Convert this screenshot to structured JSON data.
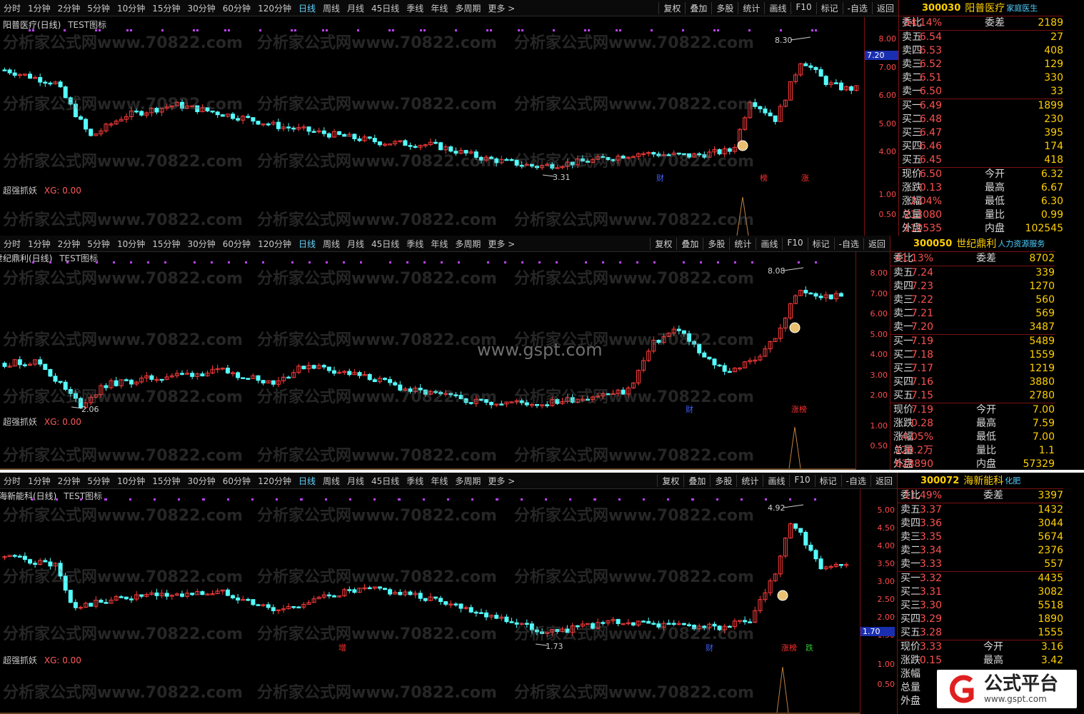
{
  "toolbar": {
    "periods": [
      "分时",
      "1分钟",
      "2分钟",
      "5分钟",
      "10分钟",
      "15分钟",
      "30分钟",
      "60分钟",
      "120分钟",
      "日线",
      "周线",
      "月线",
      "45日线",
      "季线",
      "年线",
      "多周期",
      "更多 >"
    ],
    "active_period": "日线",
    "right_buttons": [
      "复权",
      "叠加",
      "多股",
      "统计",
      "画线",
      "F10",
      "标记",
      "-自选",
      "返回"
    ]
  },
  "watermark": "分析家公式网www.70822.com",
  "site_watermark": "www.gspt.com",
  "logo": {
    "title": "公式平台",
    "url": "www.gspt.com"
  },
  "panels": [
    {
      "title": "阳普医疗(日线)",
      "indicator_tag": "TEST图标",
      "ind_name": "超强抓妖",
      "ind_value": "XG: 0.00",
      "code": "300030",
      "name": "阳普医疗",
      "industry": "家庭医生",
      "y_ticks": [
        "8.00",
        "7.00",
        "6.00",
        "5.00",
        "4.00"
      ],
      "ind_ticks": [
        "1.00",
        "0.50"
      ],
      "cur_price_tag": "7.20",
      "annotations": {
        "high": "8.30",
        "low": "3.31"
      },
      "marks": [
        "财",
        "榜",
        "涨"
      ],
      "quote": {
        "weibi": [
          "委比",
          "54.14%",
          "委差",
          "2189"
        ],
        "sell": [
          [
            "卖五",
            "6.54",
            "27"
          ],
          [
            "卖四",
            "6.53",
            "408"
          ],
          [
            "卖三",
            "6.52",
            "129"
          ],
          [
            "卖二",
            "6.51",
            "330"
          ],
          [
            "卖一",
            "6.50",
            "33"
          ]
        ],
        "buy": [
          [
            "买一",
            "6.49",
            "1899"
          ],
          [
            "买二",
            "6.48",
            "230"
          ],
          [
            "买三",
            "6.47",
            "395"
          ],
          [
            "买四",
            "6.46",
            "174"
          ],
          [
            "买五",
            "6.45",
            "418"
          ]
        ],
        "stats": [
          [
            "现价",
            "6.50",
            "今开",
            "6.32"
          ],
          [
            "涨跌",
            "0.13",
            "最高",
            "6.67"
          ],
          [
            "涨幅",
            "2.04%",
            "最低",
            "6.30"
          ],
          [
            "总量",
            "213080",
            "量比",
            "0.99"
          ],
          [
            "外盘",
            "110535",
            "内盘",
            "102545"
          ]
        ]
      }
    },
    {
      "title": "世纪鼎利(日线)",
      "indicator_tag": "TEST图标",
      "ind_name": "超强抓妖",
      "ind_value": "XG: 0.00",
      "code": "300050",
      "name": "世纪鼎利",
      "industry": "人力资源服务",
      "y_ticks": [
        "8.00",
        "7.00",
        "6.00",
        "5.00",
        "4.00",
        "3.00",
        "2.00"
      ],
      "ind_ticks": [
        "1.00",
        "0.50"
      ],
      "cur_price_tag": "",
      "annotations": {
        "high": "8.08",
        "low": "2.06"
      },
      "marks": [
        "财",
        "涨榜"
      ],
      "quote": {
        "weibi": [
          "委比",
          "41.13%",
          "委差",
          "8702"
        ],
        "sell": [
          [
            "卖五",
            "7.24",
            "339"
          ],
          [
            "卖四",
            "7.23",
            "1270"
          ],
          [
            "卖三",
            "7.22",
            "560"
          ],
          [
            "卖二",
            "7.21",
            "569"
          ],
          [
            "卖一",
            "7.20",
            "3487"
          ]
        ],
        "buy": [
          [
            "买一",
            "7.19",
            "5489"
          ],
          [
            "买二",
            "7.18",
            "1559"
          ],
          [
            "买三",
            "7.17",
            "1219"
          ],
          [
            "买四",
            "7.16",
            "3880"
          ],
          [
            "买五",
            "7.15",
            "2780"
          ]
        ],
        "stats": [
          [
            "现价",
            "7.19",
            "今开",
            "7.00"
          ],
          [
            "涨跌",
            "0.28",
            "最高",
            "7.59"
          ],
          [
            "涨幅",
            "4.05%",
            "最低",
            "7.00"
          ],
          [
            "总量",
            "120.2万",
            "量比",
            "1.1"
          ],
          [
            "外盘",
            "628890",
            "内盘",
            "57329"
          ]
        ]
      }
    },
    {
      "title": "海新能科(日线)",
      "indicator_tag": "TEST图标",
      "ind_name": "超强抓妖",
      "ind_value": "XG: 0.00",
      "code": "300072",
      "name": "海新能科",
      "industry": "化肥",
      "y_ticks": [
        "5.00",
        "4.50",
        "4.00",
        "3.50",
        "3.00",
        "2.50",
        "2.00",
        "1.50"
      ],
      "ind_ticks": [
        "1.00",
        "0.50"
      ],
      "cur_price_tag": "1.70",
      "annotations": {
        "high": "4.92",
        "low": "1.73"
      },
      "marks": [
        "增",
        "财",
        "涨榜",
        "跌"
      ],
      "quote": {
        "weibi": [
          "委比",
          "11.49%",
          "委差",
          "3397"
        ],
        "sell": [
          [
            "卖五",
            "3.37",
            "1432"
          ],
          [
            "卖四",
            "3.36",
            "3044"
          ],
          [
            "卖三",
            "3.35",
            "5674"
          ],
          [
            "卖二",
            "3.34",
            "2376"
          ],
          [
            "卖一",
            "3.33",
            "557"
          ]
        ],
        "buy": [
          [
            "买一",
            "3.32",
            "4435"
          ],
          [
            "买二",
            "3.31",
            "3082"
          ],
          [
            "买三",
            "3.30",
            "5518"
          ],
          [
            "买四",
            "3.29",
            "1890"
          ],
          [
            "买五",
            "3.28",
            "1555"
          ]
        ],
        "stats": [
          [
            "现价",
            "3.33",
            "今开",
            "3.16"
          ],
          [
            "涨跌",
            "0.15",
            "最高",
            "3.42"
          ],
          [
            "涨幅",
            "",
            "",
            " "
          ],
          [
            "总量",
            "",
            "",
            ""
          ],
          [
            "外盘",
            "",
            "",
            ""
          ]
        ]
      }
    }
  ],
  "colors": {
    "up": "#ff3c3c",
    "down": "#54ffff",
    "axis": "#ff4a4a",
    "accent": "#ffd000"
  }
}
